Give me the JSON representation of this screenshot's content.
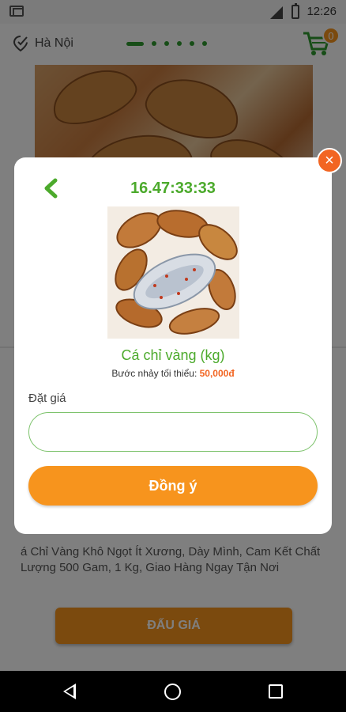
{
  "status_bar": {
    "time": "12:26"
  },
  "header": {
    "location": "Hà Nội",
    "cart_count": "0"
  },
  "background": {
    "description": "á Chỉ Vàng Khô Ngọt Ít Xương, Dày Mình, Cam Kết Chất Lượng 500 Gam, 1 Kg, Giao Hàng Ngay Tận Nơi",
    "bid_button_label": "ĐẤU GIÁ"
  },
  "modal": {
    "timer": "16.47:33:33",
    "product_name": "Cá chỉ vàng (kg)",
    "min_step_label": "Bước nhảy tối thiểu:",
    "min_step_amount": "50,000đ",
    "bid_label": "Đặt giá",
    "bid_input_value": "",
    "agree_label": "Đồng ý",
    "close_label": "×"
  },
  "colors": {
    "accent_green": "#4caa2c",
    "accent_orange": "#f7941d",
    "close_orange": "#f26522"
  },
  "icons": [
    "location-check-icon",
    "cart-icon",
    "back-chevron-icon",
    "close-icon",
    "nav-back-icon",
    "nav-home-icon",
    "nav-recent-icon"
  ]
}
